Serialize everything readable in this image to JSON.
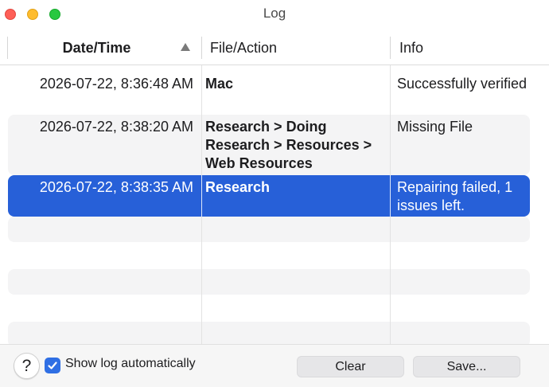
{
  "window": {
    "title": "Log"
  },
  "columns": {
    "date": "Date/Time",
    "file": "File/Action",
    "info": "Info"
  },
  "rows": [
    {
      "date": "2026-07-22, 8:36:48 AM",
      "file": "Mac",
      "info": "Successfully verified",
      "selected": false
    },
    {
      "date": "2026-07-22, 8:38:20 AM",
      "file": "Research > Doing Research > Resources > Web Resources",
      "info": "Missing File",
      "selected": false
    },
    {
      "date": "2026-07-22, 8:38:35 AM",
      "file": "Research",
      "info": "Repairing failed, 1 issues left.",
      "selected": true
    }
  ],
  "footer": {
    "help_label": "?",
    "show_log_label": "Show log automatically",
    "show_log_checked": true,
    "clear_label": "Clear",
    "save_label": "Save..."
  },
  "colors": {
    "selection": "#2760d8",
    "checkbox": "#2f6fe4",
    "stripe": "#f4f4f5"
  },
  "icons": {
    "sort": "triangle-up-icon",
    "check": "checkmark-icon"
  }
}
